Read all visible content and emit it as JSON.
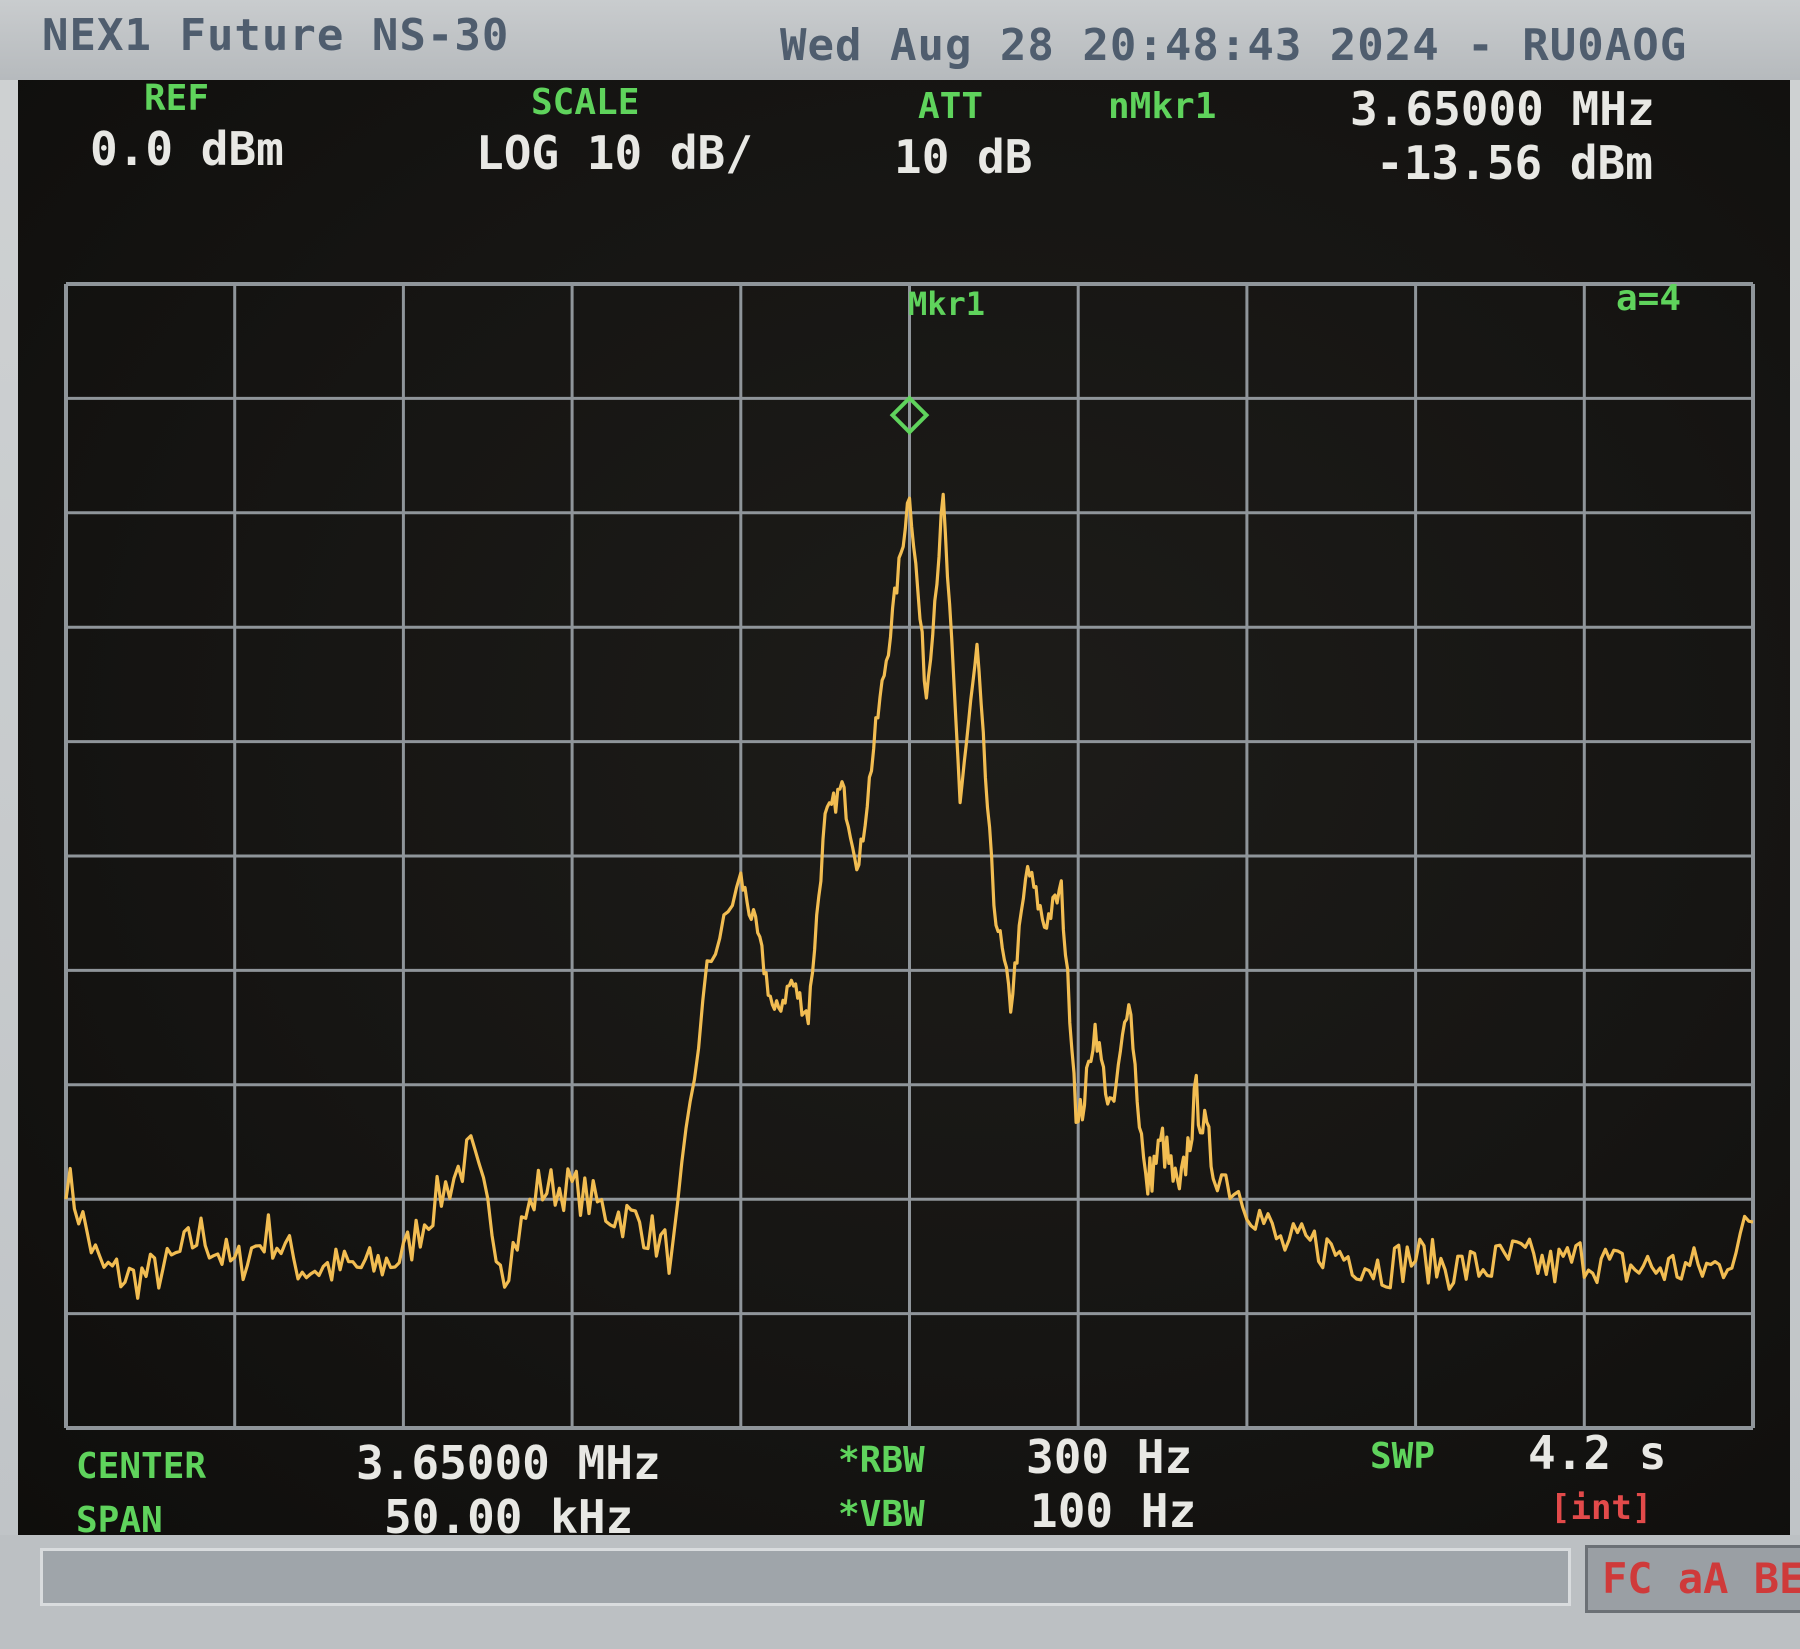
{
  "title_bar": {
    "instrument": "NEX1 Future NS-30",
    "datetime_callsign": "Wed Aug 28 20:48:43 2024 - RU0AOG"
  },
  "header": {
    "ref_label": "REF",
    "ref_value": "0.0 dBm",
    "scale_label": "SCALE",
    "scale_value": "LOG 10 dB/",
    "att_label": "ATT",
    "att_value": "10 dB",
    "marker_label": "nMkr1",
    "marker_freq": "3.65000 MHz",
    "marker_level": "-13.56 dBm"
  },
  "plot": {
    "marker_tag": "Mkr1",
    "avg_label": "a=4"
  },
  "footer": {
    "center_label": "CENTER",
    "center_value": "3.65000 MHz",
    "span_label": "SPAN",
    "span_value": "50.00 kHz",
    "rbw_label": "*RBW",
    "rbw_value": "300 Hz",
    "vbw_label": "*VBW",
    "vbw_value": "100 Hz",
    "swp_label": "SWP",
    "swp_value": "4.2 s",
    "trigger_value": "[int]"
  },
  "status": {
    "mode_text": "FC aA BE"
  },
  "colors": {
    "trace": "#f2bd52",
    "grid": "#8f959a",
    "label_green": "#5fd35c",
    "value_white": "#e8e8e4",
    "status_red": "#e24a4a"
  },
  "chart_data": {
    "type": "line",
    "title": "",
    "xlabel": "",
    "ylabel": "",
    "x_unit": "kHz offset from center",
    "y_unit": "dBm",
    "xlim": [
      -25,
      25
    ],
    "ylim": [
      -100,
      0
    ],
    "grid": true,
    "grid_divisions": {
      "x": 10,
      "y": 10
    },
    "marker": {
      "x": 0,
      "y": -13.56
    },
    "x": [
      -25,
      -24,
      -23,
      -22,
      -21,
      -20,
      -19,
      -18,
      -17,
      -16,
      -15,
      -14,
      -13,
      -12,
      -11,
      -10,
      -9,
      -8,
      -7,
      -6,
      -5,
      -4.5,
      -4,
      -3.5,
      -3,
      -2.5,
      -2,
      -1.5,
      -1,
      -0.5,
      0,
      0.5,
      1,
      1.5,
      2,
      2.5,
      3,
      3.5,
      4,
      4.5,
      5,
      5.5,
      6,
      6.5,
      7,
      7.5,
      8,
      8.5,
      9,
      10,
      11,
      12,
      13,
      14,
      15,
      16,
      17,
      18,
      19,
      20,
      21,
      22,
      23,
      24,
      25
    ],
    "series": [
      {
        "values": [
          -78,
          -86,
          -87,
          -86,
          -83,
          -86,
          -83,
          -86,
          -86,
          -86,
          -85,
          -80,
          -76,
          -86,
          -79,
          -79,
          -81,
          -82,
          -85,
          -60,
          -52,
          -57,
          -64,
          -61,
          -64,
          -47,
          -44,
          -51,
          -39,
          -29,
          -18,
          -36,
          -19,
          -45,
          -32,
          -54,
          -63,
          -51,
          -56,
          -53,
          -74,
          -65,
          -73,
          -62,
          -79,
          -75,
          -80,
          -71,
          -77,
          -80,
          -84,
          -84,
          -85,
          -86,
          -85,
          -86,
          -86,
          -85,
          -86,
          -85,
          -86,
          -86,
          -86,
          -86,
          -82
        ]
      }
    ]
  }
}
